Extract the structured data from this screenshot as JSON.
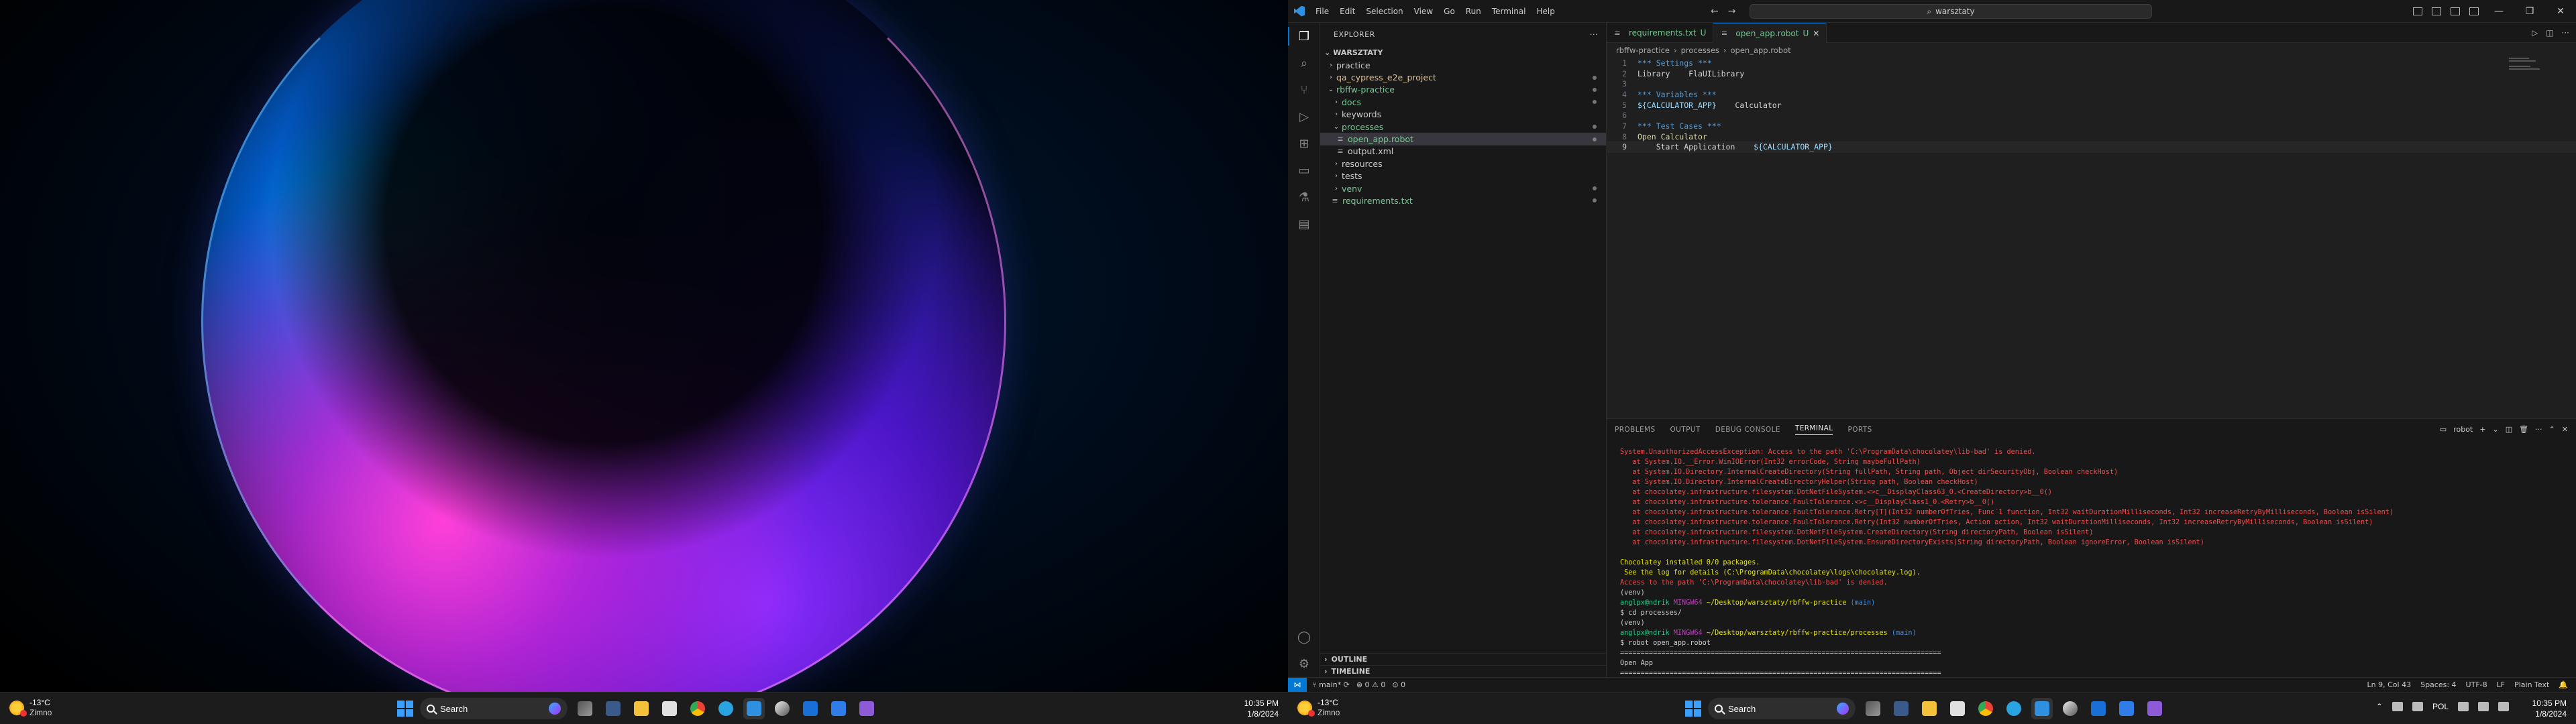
{
  "taskbar_left": {
    "weather_temp": "-13°C",
    "weather_desc": "Zimno",
    "search_label": "Search",
    "clock_time": "10:35 PM",
    "clock_date": "1/8/2024",
    "apps": [
      "widgets",
      "task-view",
      "file-explorer",
      "store",
      "chrome",
      "telegram",
      "vscode",
      "edge-dev",
      "outlook",
      "todo",
      "visual-studio"
    ],
    "active_app": "vscode"
  },
  "taskbar_right": {
    "weather_temp": "-13°C",
    "weather_desc": "Zimno",
    "search_label": "Search",
    "language": "POL",
    "clock_time": "10:35 PM",
    "clock_date": "1/8/2024"
  },
  "vscode": {
    "menu": [
      "File",
      "Edit",
      "Selection",
      "View",
      "Go",
      "Run",
      "Terminal",
      "Help"
    ],
    "command_center": "warsztaty",
    "explorer_title": "EXPLORER",
    "root_folder": "WARSZTATY",
    "tree": [
      {
        "name": "practice",
        "kind": "folder",
        "open": false,
        "depth": 0,
        "color": "white",
        "dot": false
      },
      {
        "name": "qa_cypress_e2e_project",
        "kind": "folder",
        "open": false,
        "depth": 0,
        "color": "yellow",
        "dot": true
      },
      {
        "name": "rbffw-practice",
        "kind": "folder",
        "open": true,
        "depth": 0,
        "color": "green",
        "dot": true
      },
      {
        "name": "docs",
        "kind": "folder",
        "open": false,
        "depth": 1,
        "color": "green",
        "dot": true
      },
      {
        "name": "keywords",
        "kind": "folder",
        "open": false,
        "depth": 1,
        "color": "white",
        "dot": false
      },
      {
        "name": "processes",
        "kind": "folder",
        "open": true,
        "depth": 1,
        "color": "green",
        "dot": true
      },
      {
        "name": "open_app.robot",
        "kind": "file",
        "open": false,
        "depth": 2,
        "color": "green",
        "dot": true
      },
      {
        "name": "output.xml",
        "kind": "file",
        "open": false,
        "depth": 2,
        "color": "white",
        "dot": false
      },
      {
        "name": "resources",
        "kind": "folder",
        "open": false,
        "depth": 1,
        "color": "white",
        "dot": false
      },
      {
        "name": "tests",
        "kind": "folder",
        "open": false,
        "depth": 1,
        "color": "white",
        "dot": false
      },
      {
        "name": "venv",
        "kind": "folder",
        "open": false,
        "depth": 1,
        "color": "green",
        "dot": true
      },
      {
        "name": "requirements.txt",
        "kind": "file",
        "open": false,
        "depth": 1,
        "color": "green",
        "dot": true
      }
    ],
    "outline_label": "OUTLINE",
    "timeline_label": "TIMELINE",
    "tabs": [
      {
        "label": "requirements.txt",
        "badge": "U",
        "active": false
      },
      {
        "label": "open_app.robot",
        "badge": "U",
        "active": true
      }
    ],
    "breadcrumb": [
      "rbffw-practice",
      "processes",
      "open_app.robot"
    ],
    "code_lines": [
      [
        {
          "t": "*** Settings ***",
          "c": "h"
        }
      ],
      [
        {
          "t": "Library    FlaUILibrary",
          "c": "t"
        }
      ],
      [],
      [
        {
          "t": "*** Variables ***",
          "c": "h"
        }
      ],
      [
        {
          "t": "${CALCULATOR_APP}",
          "c": "v"
        },
        {
          "t": "    Calculator",
          "c": "t"
        }
      ],
      [],
      [
        {
          "t": "*** Test Cases ***",
          "c": "h"
        }
      ],
      [
        {
          "t": "Open Calculator",
          "c": "kw"
        }
      ],
      [
        {
          "t": "    Start Application    ",
          "c": "t"
        },
        {
          "t": "${CALCULATOR_APP}",
          "c": "v"
        }
      ]
    ],
    "current_line": 9,
    "panel_tabs": [
      "PROBLEMS",
      "OUTPUT",
      "DEBUG CONSOLE",
      "TERMINAL",
      "PORTS"
    ],
    "active_panel_tab": "TERMINAL",
    "terminal_shell": "robot",
    "terminal_lines": [
      {
        "t": "System.UnauthorizedAccessException: Access to the path 'C:\\ProgramData\\chocolatey\\lib-bad' is denied.",
        "c": "red"
      },
      {
        "t": "   at System.IO.__Error.WinIOError(Int32 errorCode, String maybeFullPath)",
        "c": "red"
      },
      {
        "t": "   at System.IO.Directory.InternalCreateDirectory(String fullPath, String path, Object dirSecurityObj, Boolean checkHost)",
        "c": "red"
      },
      {
        "t": "   at System.IO.Directory.InternalCreateDirectoryHelper(String path, Boolean checkHost)",
        "c": "red"
      },
      {
        "t": "   at chocolatey.infrastructure.filesystem.DotNetFileSystem.<>c__DisplayClass63_0.<CreateDirectory>b__0()",
        "c": "red"
      },
      {
        "t": "   at chocolatey.infrastructure.tolerance.FaultTolerance.<>c__DisplayClass1_0.<Retry>b__0()",
        "c": "red"
      },
      {
        "t": "   at chocolatey.infrastructure.tolerance.FaultTolerance.Retry[T](Int32 numberOfTries, Func`1 function, Int32 waitDurationMilliseconds, Int32 increaseRetryByMilliseconds, Boolean isSilent)",
        "c": "red"
      },
      {
        "t": "   at chocolatey.infrastructure.tolerance.FaultTolerance.Retry(Int32 numberOfTries, Action action, Int32 waitDurationMilliseconds, Int32 increaseRetryByMilliseconds, Boolean isSilent)",
        "c": "red"
      },
      {
        "t": "   at chocolatey.infrastructure.filesystem.DotNetFileSystem.CreateDirectory(String directoryPath, Boolean isSilent)",
        "c": "red"
      },
      {
        "t": "   at chocolatey.infrastructure.filesystem.DotNetFileSystem.EnsureDirectoryExists(String directoryPath, Boolean ignoreError, Boolean isSilent)",
        "c": "red"
      },
      {
        "t": "",
        "c": "white"
      },
      {
        "t": "Chocolatey installed 0/0 packages.",
        "c": "yellow"
      },
      {
        "t": " See the log for details (C:\\ProgramData\\chocolatey\\logs\\chocolatey.log).",
        "c": "yellow"
      },
      {
        "t": "Access to the path 'C:\\ProgramData\\chocolatey\\lib-bad' is denied.",
        "c": "red"
      },
      {
        "t": "(venv)",
        "c": "white"
      },
      {
        "t": "PROMPT1",
        "c": "prompt"
      },
      {
        "t": "$ cd processes/",
        "c": "white"
      },
      {
        "t": "(venv)",
        "c": "white"
      },
      {
        "t": "PROMPT2",
        "c": "prompt"
      },
      {
        "t": "$ robot open_app.robot",
        "c": "white"
      },
      {
        "t": "==============================================================================",
        "c": "white"
      },
      {
        "t": "Open App",
        "c": "white"
      },
      {
        "t": "==============================================================================",
        "c": "white"
      }
    ],
    "prompt1": {
      "user": "anglpx@ndrik",
      "host": "MINGW64",
      "path": "~/Desktop/warsztaty/rbffw-practice",
      "branch": "(main)"
    },
    "prompt2": {
      "user": "anglpx@ndrik",
      "host": "MINGW64",
      "path": "~/Desktop/warsztaty/rbffw-practice/processes",
      "branch": "(main)"
    },
    "status": {
      "branch": "main*",
      "errors": "0",
      "warnings": "0",
      "ports": "0",
      "position": "Ln 9, Col 43",
      "spaces": "Spaces: 4",
      "encoding": "UTF-8",
      "eol": "LF",
      "language": "Plain Text"
    }
  },
  "colors": {
    "accent": "#0078d4",
    "editor_bg": "#1f1f1f",
    "sidebar_bg": "#181818",
    "git_added": "#73c991",
    "git_modified": "#e2c08d",
    "terminal_error": "#f14c4c"
  }
}
